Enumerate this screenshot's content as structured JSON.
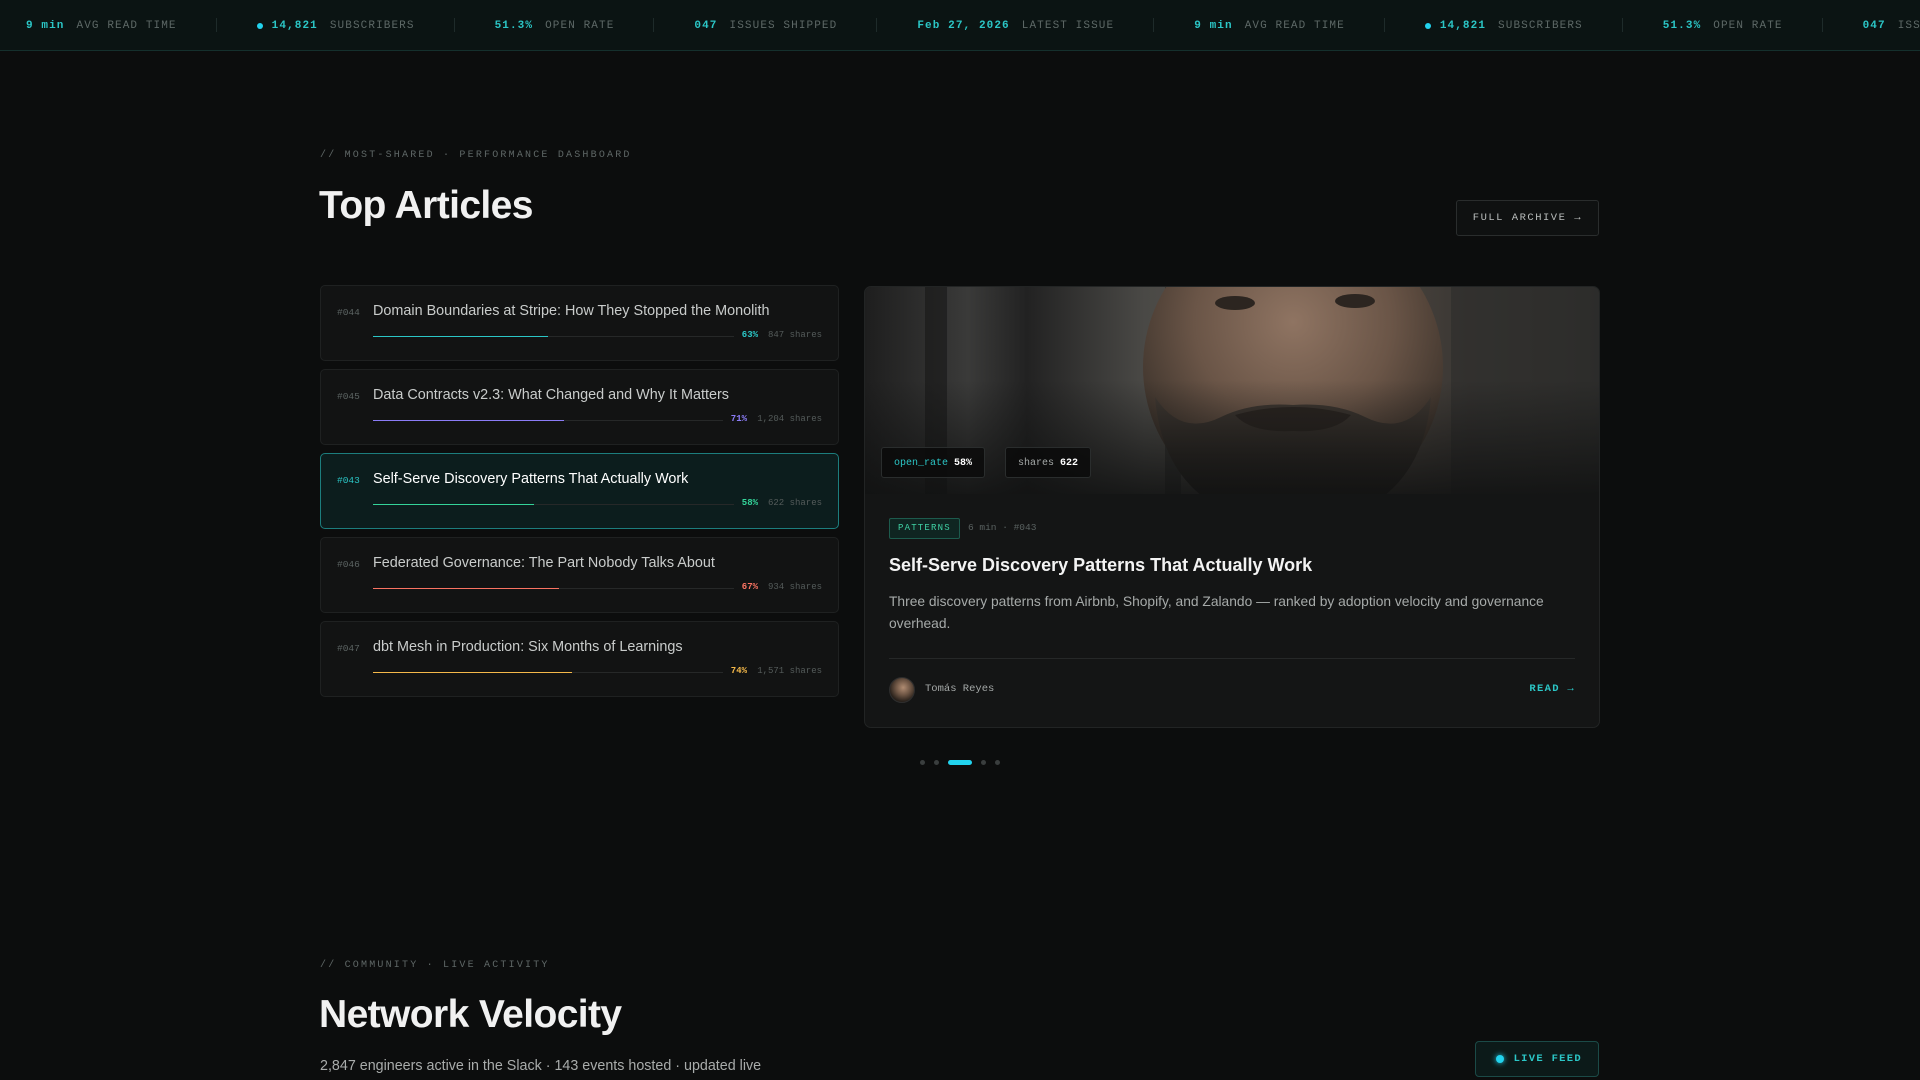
{
  "ticker": [
    {
      "value": "9 min",
      "label": "AVG READ TIME",
      "dot": false
    },
    {
      "value": "14,821",
      "label": "SUBSCRIBERS",
      "dot": true
    },
    {
      "value": "51.3%",
      "label": "OPEN RATE",
      "dot": false
    },
    {
      "value": "047",
      "label": "ISSUES SHIPPED",
      "dot": false
    },
    {
      "value": "Feb 27, 2026",
      "label": "LATEST ISSUE",
      "dot": false
    },
    {
      "value": "9 min",
      "label": "AVG READ TIME",
      "dot": false
    },
    {
      "value": "14,821",
      "label": "SUBSCRIBERS",
      "dot": true
    },
    {
      "value": "51.3%",
      "label": "OPEN RATE",
      "dot": false
    },
    {
      "value": "047",
      "label": "ISSUES SHIPPED",
      "dot": false
    },
    {
      "value": "Feb 27, 2026",
      "label": "LATEST ISSUE",
      "dot": false
    }
  ],
  "top": {
    "eyebrow": "// MOST-SHARED · PERFORMANCE DASHBOARD",
    "title": "Top Articles",
    "archive_label": "FULL ARCHIVE →"
  },
  "articles": [
    {
      "num": "#044",
      "title": "Domain Boundaries at Stripe: How They Stopped the Monolith",
      "rate": 0.63,
      "pct": "63%",
      "shares": "847 shares",
      "color": "#2bc6c6",
      "active": false
    },
    {
      "num": "#045",
      "title": "Data Contracts v2.3: What Changed and Why It Matters",
      "rate": 0.71,
      "pct": "71%",
      "shares": "1,204 shares",
      "color": "#8b7cf6",
      "active": false
    },
    {
      "num": "#043",
      "title": "Self-Serve Discovery Patterns That Actually Work",
      "rate": 0.58,
      "pct": "58%",
      "shares": "622 shares",
      "color": "#34d399",
      "active": true
    },
    {
      "num": "#046",
      "title": "Federated Governance: The Part Nobody Talks About",
      "rate": 0.67,
      "pct": "67%",
      "shares": "934 shares",
      "color": "#f97362",
      "active": false
    },
    {
      "num": "#047",
      "title": "dbt Mesh in Production: Six Months of Learnings",
      "rate": 0.74,
      "pct": "74%",
      "shares": "1,571 shares",
      "color": "#f5b94a",
      "active": false
    }
  ],
  "feature": {
    "chip_rate_key": "open_rate",
    "chip_rate_val": "58%",
    "chip_shares_key": "shares",
    "chip_shares_val": "622",
    "tag": "PATTERNS",
    "meta": "6 min · #043",
    "title": "Self-Serve Discovery Patterns That Actually Work",
    "desc": "Three discovery patterns from Airbnb, Shopify, and Zalando — ranked by adoption velocity and governance overhead.",
    "author": "Tomás Reyes",
    "read_label": "READ →",
    "chip_rate_color": "#2bc6c6",
    "chip_shares_color": "#a5a9a8"
  },
  "carousel": {
    "count": 5,
    "active_index": 2
  },
  "network": {
    "eyebrow": "// COMMUNITY · LIVE ACTIVITY",
    "title": "Network Velocity",
    "subtitle": "2,847 engineers active in the Slack · 143 events hosted · updated live",
    "live_label": "LIVE FEED"
  }
}
